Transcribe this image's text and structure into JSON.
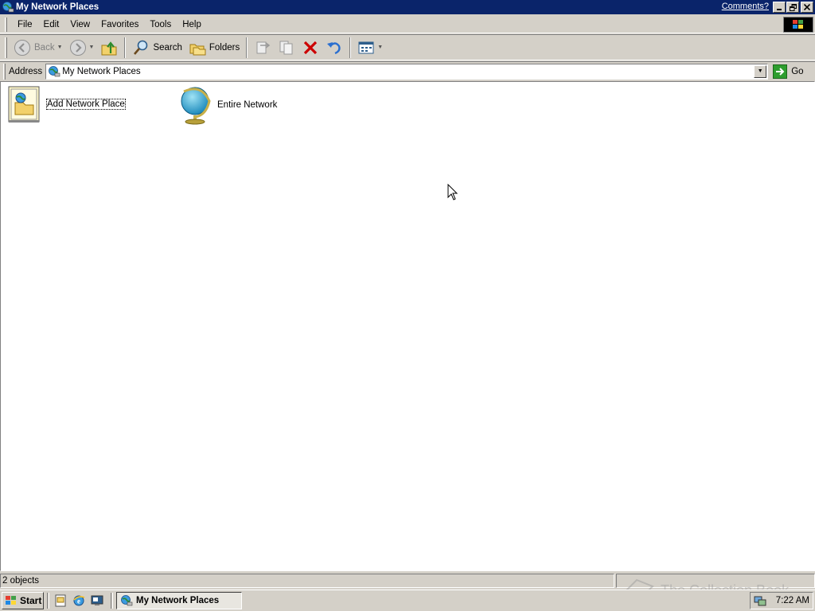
{
  "window": {
    "title": "My Network Places",
    "comments_link": "Comments?"
  },
  "menu": {
    "items": [
      "File",
      "Edit",
      "View",
      "Favorites",
      "Tools",
      "Help"
    ]
  },
  "toolbar": {
    "back_label": "Back",
    "search_label": "Search",
    "folders_label": "Folders"
  },
  "address": {
    "label": "Address",
    "value": "My Network Places",
    "go_label": "Go"
  },
  "items": [
    {
      "label": "Add Network Place",
      "icon": "add-network-place-icon"
    },
    {
      "label": "Entire Network",
      "icon": "globe-icon"
    }
  ],
  "status": {
    "text": "2 objects"
  },
  "taskbar": {
    "start_label": "Start",
    "task_label": "My Network Places",
    "clock": "7:22 AM"
  },
  "watermark": "The Collection Book",
  "colors": {
    "titlebar": "#0a246a",
    "face": "#d4d0c8",
    "delete_red": "#cc0000"
  }
}
